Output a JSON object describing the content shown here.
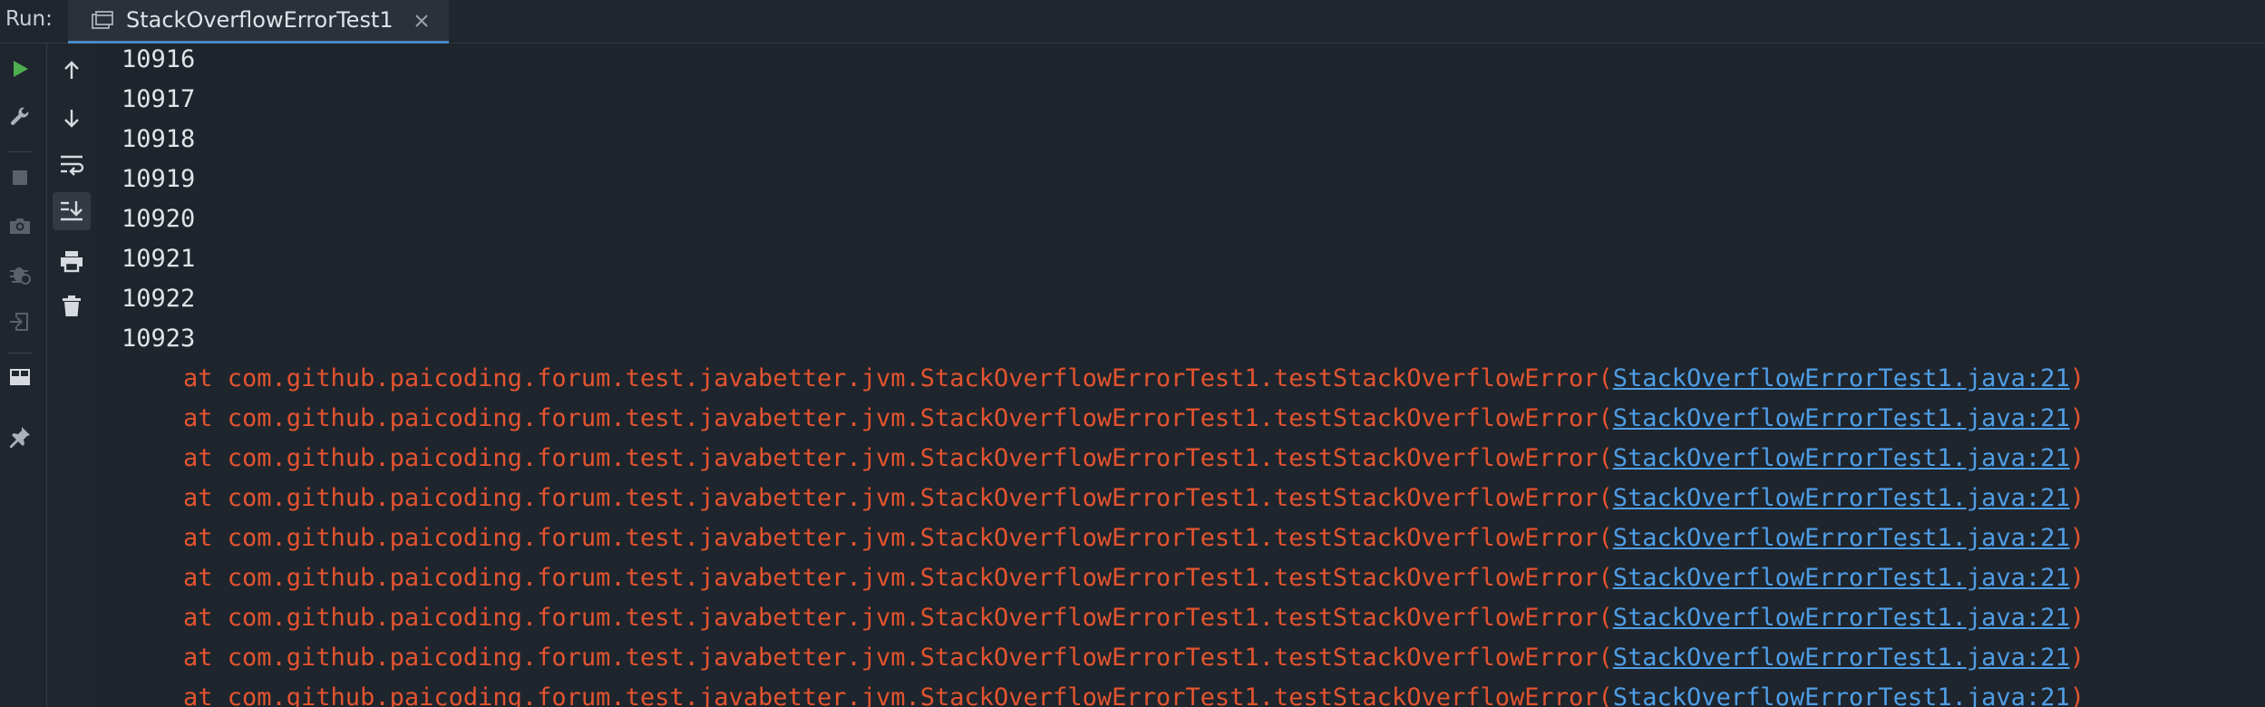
{
  "run_panel": {
    "label": "Run:",
    "tab_title": "StackOverflowErrorTest1"
  },
  "colors": {
    "background": "#1f252d",
    "stdout": "#e1e4e8",
    "stderr": "#e3542f",
    "link": "#4f9ee6",
    "run_green": "#4caf50",
    "tab_underline": "#4a88c7"
  },
  "left_toolbar": {
    "items": [
      {
        "icon": "run-icon",
        "enabled": true
      },
      {
        "icon": "wrench-icon",
        "enabled": true
      },
      {
        "icon": "stop-icon",
        "enabled": false
      },
      {
        "icon": "camera-icon",
        "enabled": false
      },
      {
        "icon": "debug-icon",
        "enabled": false
      },
      {
        "icon": "login-icon",
        "enabled": false
      },
      {
        "icon": "layout-icon",
        "enabled": true
      },
      {
        "icon": "pin-icon",
        "enabled": true
      }
    ]
  },
  "console_toolbar": {
    "items": [
      {
        "icon": "arrow-up-icon"
      },
      {
        "icon": "arrow-down-icon"
      },
      {
        "icon": "soft-wrap-icon"
      },
      {
        "icon": "scroll-to-end-icon"
      },
      {
        "icon": "print-icon"
      },
      {
        "icon": "trash-icon"
      }
    ]
  },
  "console": {
    "output_numbers": [
      "10916",
      "10917",
      "10918",
      "10919",
      "10920",
      "10921",
      "10922",
      "10923"
    ],
    "trace_lines": [
      {
        "prefix": "at com.github.paicoding.forum.test.javabetter.jvm.StackOverflowErrorTest1.testStackOverflowError(",
        "link": "StackOverflowErrorTest1.java:21",
        "suffix": ")"
      },
      {
        "prefix": "at com.github.paicoding.forum.test.javabetter.jvm.StackOverflowErrorTest1.testStackOverflowError(",
        "link": "StackOverflowErrorTest1.java:21",
        "suffix": ")"
      },
      {
        "prefix": "at com.github.paicoding.forum.test.javabetter.jvm.StackOverflowErrorTest1.testStackOverflowError(",
        "link": "StackOverflowErrorTest1.java:21",
        "suffix": ")"
      },
      {
        "prefix": "at com.github.paicoding.forum.test.javabetter.jvm.StackOverflowErrorTest1.testStackOverflowError(",
        "link": "StackOverflowErrorTest1.java:21",
        "suffix": ")"
      },
      {
        "prefix": "at com.github.paicoding.forum.test.javabetter.jvm.StackOverflowErrorTest1.testStackOverflowError(",
        "link": "StackOverflowErrorTest1.java:21",
        "suffix": ")"
      },
      {
        "prefix": "at com.github.paicoding.forum.test.javabetter.jvm.StackOverflowErrorTest1.testStackOverflowError(",
        "link": "StackOverflowErrorTest1.java:21",
        "suffix": ")"
      },
      {
        "prefix": "at com.github.paicoding.forum.test.javabetter.jvm.StackOverflowErrorTest1.testStackOverflowError(",
        "link": "StackOverflowErrorTest1.java:21",
        "suffix": ")"
      },
      {
        "prefix": "at com.github.paicoding.forum.test.javabetter.jvm.StackOverflowErrorTest1.testStackOverflowError(",
        "link": "StackOverflowErrorTest1.java:21",
        "suffix": ")"
      },
      {
        "prefix": "at com.github.paicoding.forum.test.javabetter.jvm.StackOverflowErrorTest1.testStackOverflowError(",
        "link": "StackOverflowErrorTest1.java:21",
        "suffix": ")"
      }
    ]
  }
}
